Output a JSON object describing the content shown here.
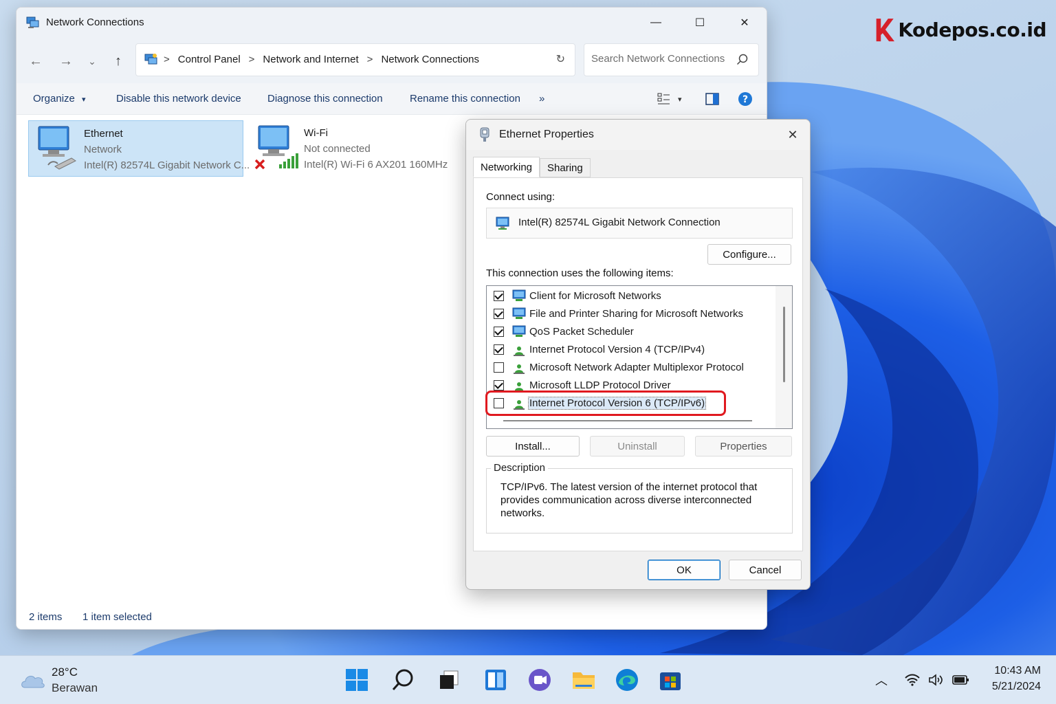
{
  "watermark": {
    "text": "Kodepos.co.id"
  },
  "explorer": {
    "title": "Network Connections",
    "window_controls": {
      "minimize": "—",
      "maximize": "☐",
      "close": "✕"
    },
    "nav": {
      "back": "←",
      "forward": "→",
      "recent": "⌄",
      "up": "↑"
    },
    "breadcrumbs": [
      "Control Panel",
      "Network and Internet",
      "Network Connections"
    ],
    "breadcrumb_separator": ">",
    "refresh_glyph": "↻",
    "search_placeholder": "Search Network Connections",
    "commands": {
      "organize": "Organize",
      "organize_caret": "▾",
      "disable": "Disable this network device",
      "diagnose": "Diagnose this connection",
      "rename": "Rename this connection",
      "more": "»",
      "view_caret": "▾"
    },
    "connections": [
      {
        "name": "Ethernet",
        "status": "Network",
        "adapter": "Intel(R) 82574L Gigabit Network C...",
        "selected": true,
        "icon": "ethernet-adapter-icon"
      },
      {
        "name": "Wi-Fi",
        "status": "Not connected",
        "adapter": "Intel(R) Wi-Fi 6 AX201 160MHz",
        "selected": false,
        "icon": "wifi-adapter-icon"
      }
    ],
    "status": {
      "count": "2 items",
      "selection": "1 item selected"
    }
  },
  "dialog": {
    "title": "Ethernet Properties",
    "close": "✕",
    "tabs": [
      {
        "label": "Networking",
        "active": true
      },
      {
        "label": "Sharing",
        "active": false
      }
    ],
    "connect_using_label": "Connect using:",
    "adapter_name": "Intel(R) 82574L Gigabit Network Connection",
    "configure_button": "Configure...",
    "items_label": "This connection uses the following items:",
    "items": [
      {
        "label": "Client for Microsoft Networks",
        "checked": true,
        "icon": "network-client-icon"
      },
      {
        "label": "File and Printer Sharing for Microsoft Networks",
        "checked": true,
        "icon": "network-service-icon"
      },
      {
        "label": "QoS Packet Scheduler",
        "checked": true,
        "icon": "network-service-icon"
      },
      {
        "label": "Internet Protocol Version 4 (TCP/IPv4)",
        "checked": true,
        "icon": "protocol-icon"
      },
      {
        "label": "Microsoft Network Adapter Multiplexor Protocol",
        "checked": false,
        "icon": "protocol-icon"
      },
      {
        "label": "Microsoft LLDP Protocol Driver",
        "checked": true,
        "icon": "protocol-icon"
      },
      {
        "label": "Internet Protocol Version 6 (TCP/IPv6)",
        "checked": false,
        "icon": "protocol-icon",
        "highlighted": true
      }
    ],
    "install_button": "Install...",
    "uninstall_button": "Uninstall",
    "properties_button": "Properties",
    "description_label": "Description",
    "description_text": "TCP/IPv6. The latest version of the internet protocol that provides communication across diverse interconnected networks.",
    "ok_button": "OK",
    "cancel_button": "Cancel",
    "annotation_color": "#e0191f"
  },
  "taskbar": {
    "weather": {
      "temp": "28°C",
      "condition": "Berawan"
    },
    "apps": [
      "start-icon",
      "search-icon",
      "task-view-icon",
      "widgets-icon",
      "chat-icon",
      "file-explorer-icon",
      "edge-icon",
      "store-icon"
    ],
    "tray": {
      "chevron": "︿"
    },
    "clock": {
      "time": "10:43 AM",
      "date": "5/21/2024"
    }
  },
  "colors": {
    "accent": "#0067c0",
    "selection": "#cce4f7",
    "brand_red": "#d6202a"
  }
}
